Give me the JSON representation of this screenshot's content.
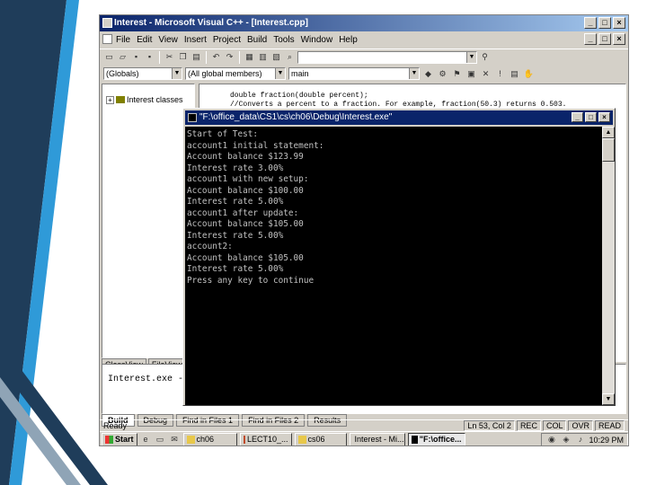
{
  "window": {
    "title": "Interest - Microsoft Visual C++ - [Interest.cpp]"
  },
  "menu": [
    "File",
    "Edit",
    "View",
    "Insert",
    "Project",
    "Build",
    "Tools",
    "Window",
    "Help"
  ],
  "toolbar": {
    "class_combo": "(Globals)",
    "members_combo": "(All global members)",
    "function_combo": "main"
  },
  "workspace": {
    "tree_root": "Interest classes",
    "tabs": [
      "ClassView",
      "FileView"
    ]
  },
  "editor": {
    "lines": [
      "double fraction(double percent);",
      "//Converts a percent to a fraction. For example, fraction(50.3) returns 0.503."
    ]
  },
  "console": {
    "title": "\"F:\\office_data\\CS1\\cs\\ch06\\Debug\\Interest.exe\"",
    "output_lines": [
      "Start of Test:",
      "account1 initial statement:",
      "Account balance $123.99",
      "Interest rate 3.00%",
      "account1 with new setup:",
      "Account balance $100.00",
      "Interest rate 5.00%",
      "account1 after update:",
      "Account balance $105.00",
      "Interest rate 5.00%",
      "account2:",
      "Account balance $105.00",
      "Interest rate 5.00%",
      "Press any key to continue"
    ]
  },
  "output_pane": {
    "text": "Interest.exe - 0",
    "tabs": [
      "Build",
      "Debug",
      "Find in Files 1",
      "Find in Files 2",
      "Results"
    ]
  },
  "statusbar": {
    "left": "Ready",
    "position": "Ln 53, Col 2",
    "indicators": [
      "REC",
      "COL",
      "OVR",
      "READ"
    ]
  },
  "taskbar": {
    "start": "Start",
    "buttons": [
      "ch06",
      "LECT10_...",
      "cs06",
      "Interest - Mi...",
      "\"F:\\office..."
    ],
    "clock": "10:29 PM"
  },
  "colors": {
    "title_active": "#0a246a",
    "title_gradient_end": "#a6caf0",
    "face": "#d4d0c8",
    "console_bg": "#000000",
    "console_text": "#c0c0c0",
    "stripe_dark": "#1f3d5a",
    "stripe_light": "#2f9ad8"
  }
}
